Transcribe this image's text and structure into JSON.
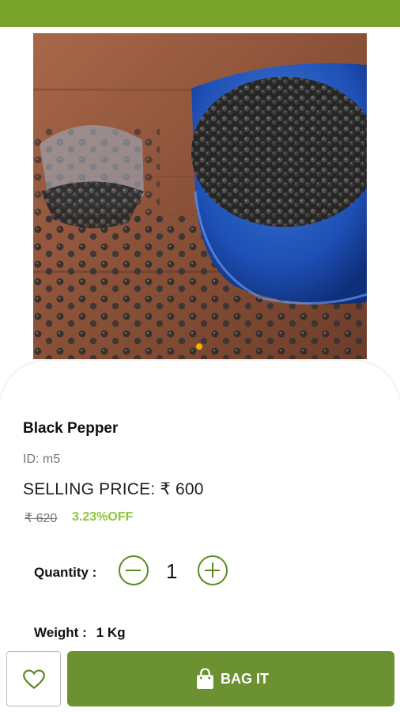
{
  "product": {
    "name": "Black Pepper",
    "id_text": "ID: m5",
    "selling_price_text": "SELLING PRICE: ₹ 600",
    "mrp_text": "₹ 620",
    "discount_text": "3.23%OFF"
  },
  "quantity": {
    "label": "Quantity :",
    "value": "1"
  },
  "weight": {
    "label": "Weight :",
    "value": "1 Kg"
  },
  "actions": {
    "bag_label": "BAG IT"
  },
  "icons": {
    "favorite": "heart-outline-icon",
    "bag": "shopping-bag-icon",
    "decrease": "minus-circle-icon",
    "increase": "plus-circle-icon"
  },
  "colors": {
    "brand_green": "#7aa52a",
    "button_green": "#6b9130",
    "discount_green": "#8cc63f",
    "stepper_green": "#5a8a1e",
    "carousel_dot": "#f0b400"
  },
  "carousel": {
    "active_index": 0,
    "count": 1
  }
}
